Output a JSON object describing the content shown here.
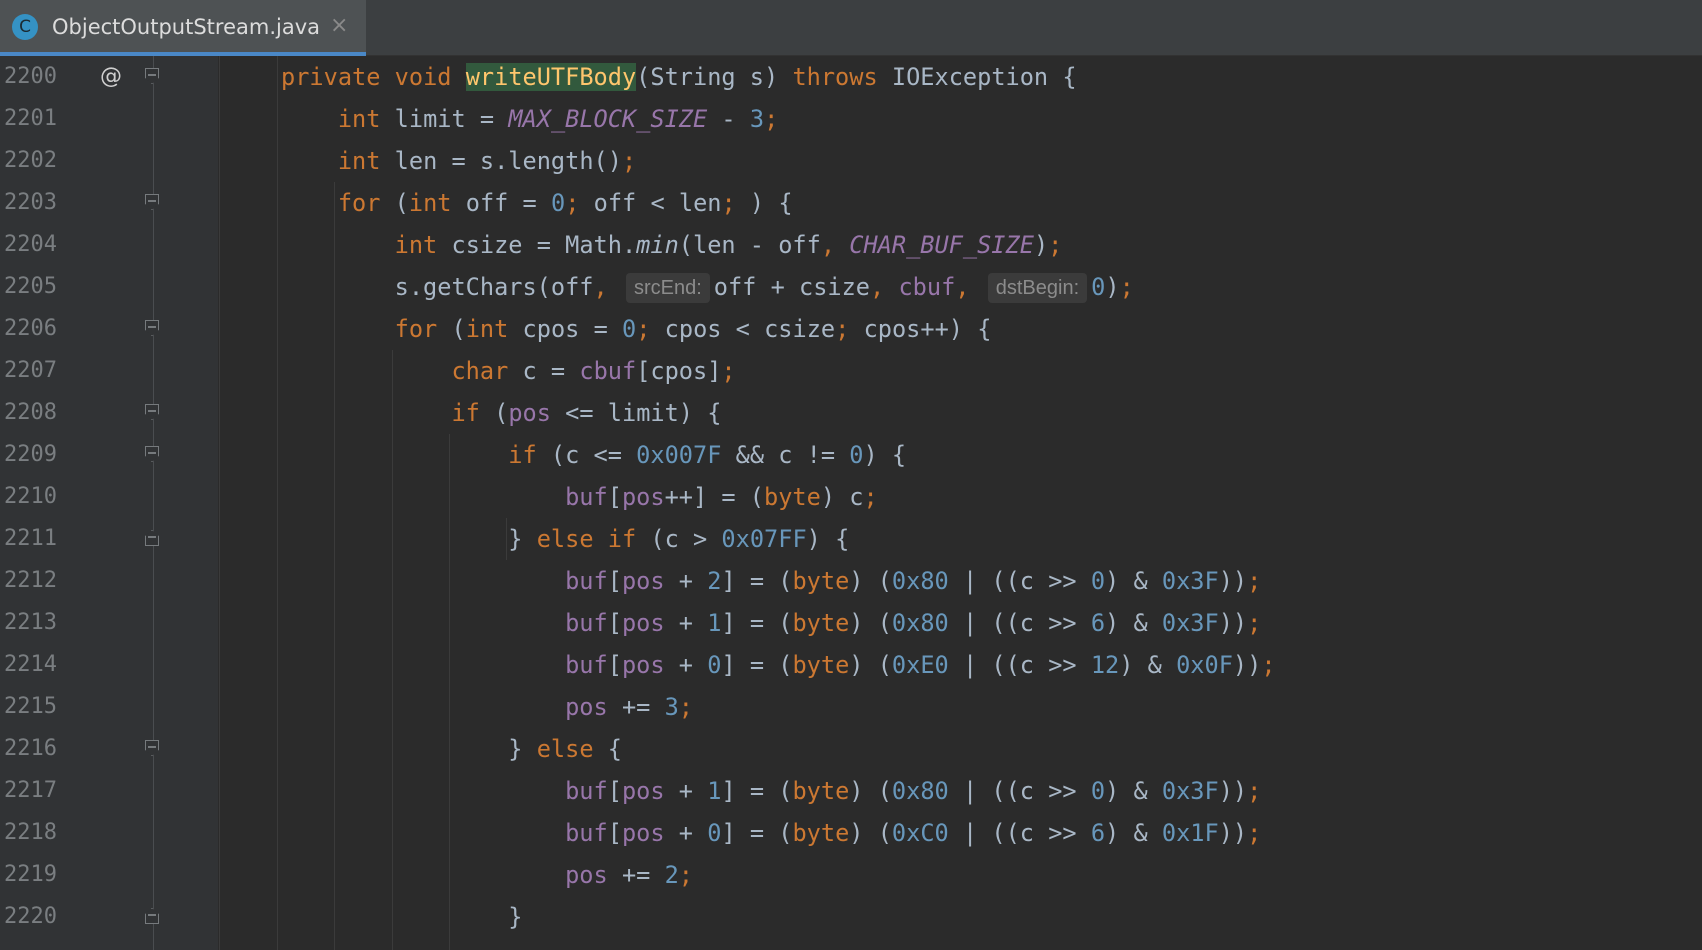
{
  "tab": {
    "icon_letter": "C",
    "title": "ObjectOutputStream.java",
    "close": "×"
  },
  "gutter": {
    "override_marker": "@"
  },
  "line_numbers": [
    "2200",
    "2201",
    "2202",
    "2203",
    "2204",
    "2205",
    "2206",
    "2207",
    "2208",
    "2209",
    "2210",
    "2211",
    "2212",
    "2213",
    "2214",
    "2215",
    "2216",
    "2217",
    "2218",
    "2219",
    "2220"
  ],
  "code": {
    "l2200": {
      "t1": "private",
      "t2": "void",
      "t3": "writeUTFBody",
      "t4": "(String s)",
      "t5": "throws",
      "t6": "IOException {"
    },
    "l2201": {
      "t1": "int",
      "t2": "limit =",
      "t3": "MAX_BLOCK_SIZE",
      "t4": "-",
      "t5": "3",
      "t6": ";"
    },
    "l2202": {
      "t1": "int",
      "t2": "len = s.length()",
      "t3": ";"
    },
    "l2203": {
      "t1": "for",
      "t2": "(",
      "t3": "int",
      "t4": "off =",
      "t5": "0",
      "t6": ";",
      "t7": "off < len",
      "t8": ";",
      "t9": ") {"
    },
    "l2204": {
      "t1": "int",
      "t2": "csize = Math.",
      "t3": "min",
      "t4": "(len - off",
      "t5": ",",
      "t6": "CHAR_BUF_SIZE",
      "t7": ")",
      "t8": ";"
    },
    "l2205": {
      "t1": "s.getChars(off",
      "t2": ",",
      "h1": "srcEnd:",
      "t3": "off + csize",
      "t4": ",",
      "t5": "cbuf",
      "t6": ",",
      "h2": "dstBegin:",
      "t7": "0",
      "t8": ")",
      "t9": ";"
    },
    "l2206": {
      "t1": "for",
      "t2": "(",
      "t3": "int",
      "t4": "cpos =",
      "t5": "0",
      "t6": ";",
      "t7": "cpos < csize",
      "t8": ";",
      "t9": "cpos++) {"
    },
    "l2207": {
      "t1": "char",
      "t2": "c =",
      "t3": "cbuf",
      "t4": "[cpos]",
      "t5": ";"
    },
    "l2208": {
      "t1": "if",
      "t2": "(",
      "t3": "pos",
      "t4": "<= limit) {"
    },
    "l2209": {
      "t1": "if",
      "t2": "(c <=",
      "t3": "0x007F",
      "t4": "&& c !=",
      "t5": "0",
      "t6": ") {"
    },
    "l2210": {
      "t1": "buf",
      "t2": "[",
      "t3": "pos",
      "t4": "++] = (",
      "t5": "byte",
      "t6": ") c",
      "t7": ";"
    },
    "l2211": {
      "t1": "}",
      "t2": "else if",
      "t3": "(c >",
      "t4": "0x07FF",
      "t5": ") {"
    },
    "l2212": {
      "t1": "buf",
      "t2": "[",
      "t3": "pos",
      "t4": "+",
      "t5": "2",
      "t6": "] = (",
      "t7": "byte",
      "t8": ") (",
      "t9": "0x80",
      "t10": "| ((c >>",
      "t11": "0",
      "t12": ") &",
      "t13": "0x3F",
      "t14": "))",
      "t15": ";"
    },
    "l2213": {
      "t1": "buf",
      "t2": "[",
      "t3": "pos",
      "t4": "+",
      "t5": "1",
      "t6": "] = (",
      "t7": "byte",
      "t8": ") (",
      "t9": "0x80",
      "t10": "| ((c >>",
      "t11": "6",
      "t12": ") &",
      "t13": "0x3F",
      "t14": "))",
      "t15": ";"
    },
    "l2214": {
      "t1": "buf",
      "t2": "[",
      "t3": "pos",
      "t4": "+",
      "t5": "0",
      "t6": "] = (",
      "t7": "byte",
      "t8": ") (",
      "t9": "0xE0",
      "t10": "| ((c >>",
      "t11": "12",
      "t12": ") &",
      "t13": "0x0F",
      "t14": "))",
      "t15": ";"
    },
    "l2215": {
      "t1": "pos",
      "t2": "+=",
      "t3": "3",
      "t4": ";"
    },
    "l2216": {
      "t1": "}",
      "t2": "else",
      "t3": "{"
    },
    "l2217": {
      "t1": "buf",
      "t2": "[",
      "t3": "pos",
      "t4": "+",
      "t5": "1",
      "t6": "] = (",
      "t7": "byte",
      "t8": ") (",
      "t9": "0x80",
      "t10": "| ((c >>",
      "t11": "0",
      "t12": ") &",
      "t13": "0x3F",
      "t14": "))",
      "t15": ";"
    },
    "l2218": {
      "t1": "buf",
      "t2": "[",
      "t3": "pos",
      "t4": "+",
      "t5": "0",
      "t6": "] = (",
      "t7": "byte",
      "t8": ") (",
      "t9": "0xC0",
      "t10": "| ((c >>",
      "t11": "6",
      "t12": ") &",
      "t13": "0x1F",
      "t14": "))",
      "t15": ";"
    },
    "l2219": {
      "t1": "pos",
      "t2": "+=",
      "t3": "2",
      "t4": ";"
    },
    "l2220": {
      "t1": "}"
    }
  }
}
